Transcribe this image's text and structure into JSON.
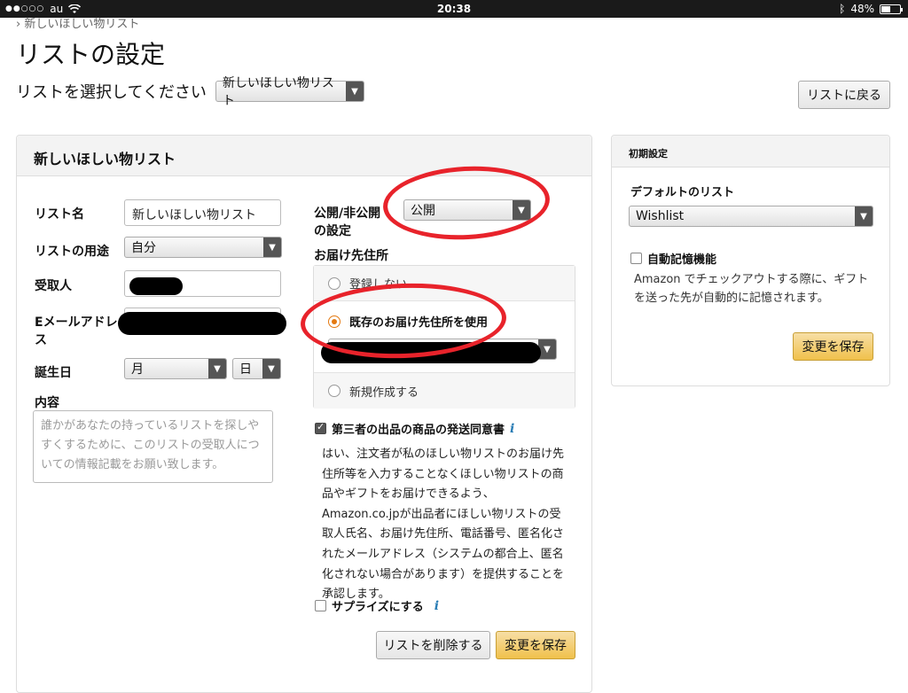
{
  "status_bar": {
    "carrier": "au",
    "time": "20:38",
    "battery": "48%",
    "battery_fraction": 0.48
  },
  "breadcrumb": "› 新しいほしい物リスト",
  "page_title": "リストの設定",
  "list_select": {
    "label": "リストを選択してください",
    "value": "新しいほしい物リスト"
  },
  "back_button": "リストに戻る",
  "main_panel": {
    "title": "新しいほしい物リスト",
    "fields": {
      "list_name_label": "リスト名",
      "list_name_value": "新しいほしい物リスト",
      "purpose_label": "リストの用途",
      "purpose_value": "自分",
      "recipient_label": "受取人",
      "email_label": "Eメールアドレス",
      "birthday_label": "誕生日",
      "month_value": "月",
      "day_value": "日",
      "content_label": "内容",
      "content_placeholder": "誰かがあなたの持っているリストを探しやすくするために、このリストの受取人についての情報記載をお願い致します。"
    },
    "visibility": {
      "label": "公開/非公開の設定",
      "value": "公開"
    },
    "address": {
      "label": "お届け先住所",
      "options": [
        "登録しない",
        "既存のお届け先住所を使用",
        "新規作成する"
      ],
      "selected_index": 1
    },
    "third_party": {
      "label": "第三者の出品の商品の発送同意書",
      "checked": true,
      "text": "はい、注文者が私のほしい物リストのお届け先住所等を入力することなくほしい物リストの商品やギフトをお届けできるよう、Amazon.co.jpが出品者にほしい物リストの受取人氏名、お届け先住所、電話番号、匿名化されたメールアドレス（システムの都合上、匿名化されない場合があります）を提供することを承認します。"
    },
    "surprise": {
      "label": "サプライズにする",
      "checked": false
    },
    "delete_button": "リストを削除する",
    "save_button": "変更を保存"
  },
  "side_panel": {
    "title": "初期設定",
    "default_list_label": "デフォルトのリスト",
    "default_list_value": "Wishlist",
    "auto_remember_label": "自動記憶機能",
    "auto_remember_checked": false,
    "auto_remember_text": "Amazon でチェックアウトする際に、ギフトを送った先が自動的に記憶されます。",
    "save_button": "変更を保存"
  },
  "colors": {
    "accent": "#e47911",
    "primary_button": "#f0c14b",
    "annotation_red": "#e8232b",
    "info_icon": "#2a7db5"
  }
}
